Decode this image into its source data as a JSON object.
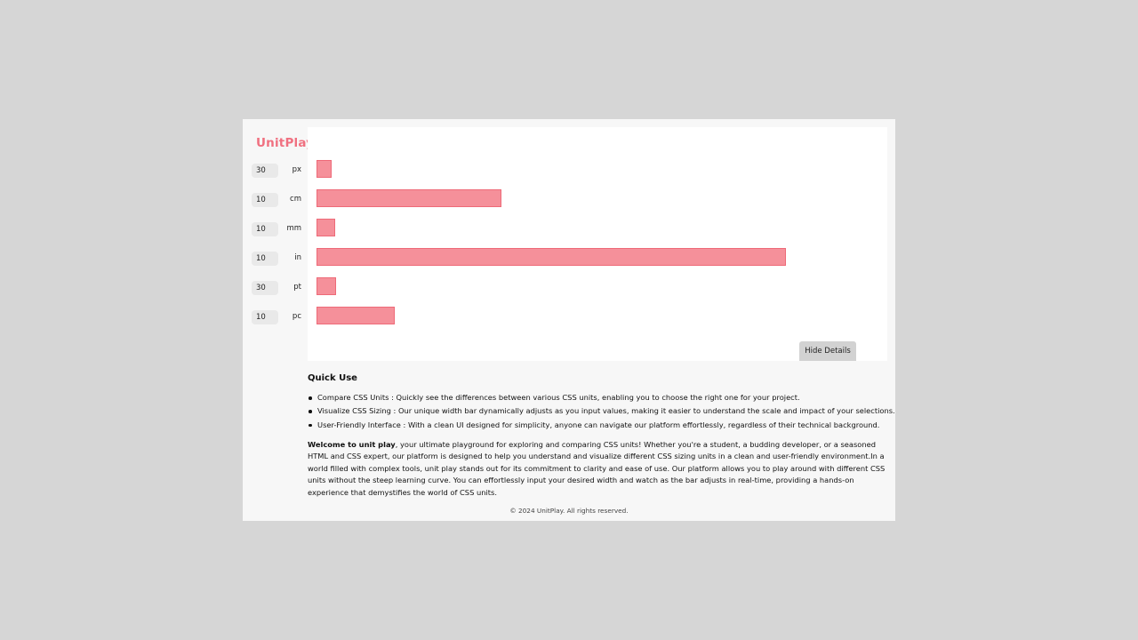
{
  "app": {
    "logo": "UnitPlay"
  },
  "units": [
    {
      "value": "30",
      "unit": "px"
    },
    {
      "value": "10",
      "unit": "cm"
    },
    {
      "value": "10",
      "unit": "mm"
    },
    {
      "value": "10",
      "unit": "in"
    },
    {
      "value": "30",
      "unit": "pt"
    },
    {
      "value": "10",
      "unit": "pc"
    }
  ],
  "colors": {
    "accent": "#f07080",
    "bar_fill": "#f5909a",
    "bar_border": "#ee6a78"
  },
  "controls": {
    "hide_details_label": "Hide Details"
  },
  "details": {
    "quick_use_title": "Quick Use",
    "features": [
      "Compare CSS Units : Quickly see the differences between various CSS units, enabling you to choose the right one for your project.",
      "Visualize CSS Sizing : Our unique width bar dynamically adjusts as you input values, making it easier to understand the scale and impact of your selections.",
      "User-Friendly Interface : With a clean UI designed for simplicity, anyone can navigate our platform effortlessly, regardless of their technical background."
    ],
    "intro_bold": "Welcome to unit play",
    "intro_text": ", your ultimate playground for exploring and comparing CSS units! Whether you're a student, a budding developer, or a seasoned HTML and CSS expert, our platform is designed to help you understand and visualize different CSS sizing units in a clean and user-friendly environment.In a world filled with complex tools, unit play stands out for its commitment to clarity and ease of use. Our platform allows you to play around with different CSS units without the steep learning curve. You can effortlessly input your desired width and watch as the bar adjusts in real-time, providing a hands-on experience that demystifies the world of CSS units."
  },
  "footer": {
    "text": "© 2024 UnitPlay. All rights reserved."
  }
}
